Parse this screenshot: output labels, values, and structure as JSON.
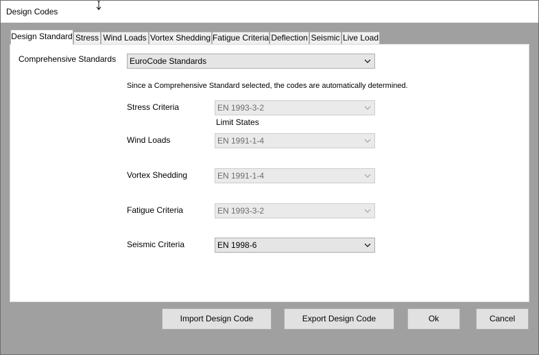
{
  "window": {
    "title": "Design Codes"
  },
  "tabs": [
    {
      "label": "Design Standard"
    },
    {
      "label": "Stress"
    },
    {
      "label": "Wind Loads"
    },
    {
      "label": "Vortex Shedding"
    },
    {
      "label": "Fatigue Criteria"
    },
    {
      "label": "Deflection"
    },
    {
      "label": "Seismic"
    },
    {
      "label": "Live Load"
    }
  ],
  "form": {
    "comprehensive_label": "Comprehensive Standards",
    "comprehensive_value": "EuroCode Standards",
    "note": "Since a Comprehensive Standard selected, the codes are automatically determined.",
    "stress_label": "Stress Criteria",
    "stress_value": "EN 1993-3-2",
    "limit_states_label": "Limit States",
    "wind_label": "Wind Loads",
    "wind_value": "EN 1991-1-4",
    "vortex_label": "Vortex Shedding",
    "vortex_value": "EN 1991-1-4",
    "fatigue_label": "Fatigue Criteria",
    "fatigue_value": "EN 1993-3-2",
    "seismic_label": "Seismic Criteria",
    "seismic_value": "EN 1998-6"
  },
  "buttons": {
    "import": "Import Design Code",
    "export": "Export Design Code",
    "ok": "Ok",
    "cancel": "Cancel"
  },
  "icons": {
    "cursor": "resize-vertical-cursor-icon",
    "dropdown": "chevron-down-icon"
  }
}
